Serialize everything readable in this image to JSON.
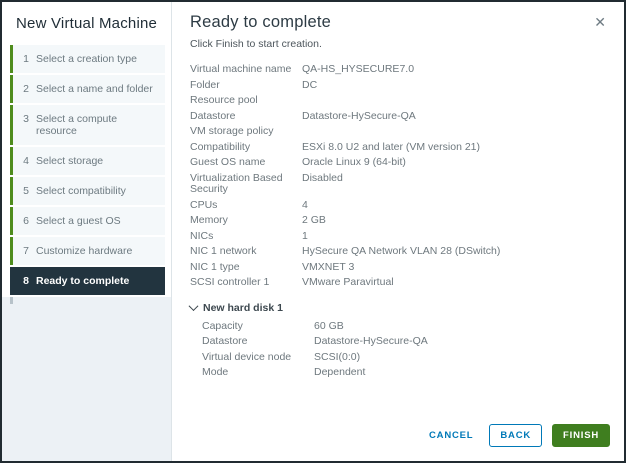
{
  "colors": {
    "step_bar_green": "#4f8c1d",
    "active_step_bg": "#22343f",
    "link_blue": "#0079b8",
    "finish_green": "#3f7e1f",
    "sidebar_filler": "#ecf1f5"
  },
  "icons": {
    "close_glyph": "✕"
  },
  "sidebar": {
    "title": "New Virtual Machine",
    "steps": [
      {
        "num": "1",
        "label": "Select a creation type"
      },
      {
        "num": "2",
        "label": "Select a name and folder"
      },
      {
        "num": "3",
        "label": "Select a compute resource"
      },
      {
        "num": "4",
        "label": "Select storage"
      },
      {
        "num": "5",
        "label": "Select compatibility"
      },
      {
        "num": "6",
        "label": "Select a guest OS"
      },
      {
        "num": "7",
        "label": "Customize hardware"
      },
      {
        "num": "8",
        "label": "Ready to complete"
      }
    ]
  },
  "main": {
    "title": "Ready to complete",
    "subtitle": "Click Finish to start creation.",
    "summary_rows": [
      {
        "label": "Virtual machine name",
        "value": "QA-HS_HYSECURE7.0"
      },
      {
        "label": "Folder",
        "value": "DC"
      },
      {
        "label": "Resource pool",
        "value": ""
      },
      {
        "label": "Datastore",
        "value": "Datastore-HySecure-QA"
      },
      {
        "label": "VM storage policy",
        "value": ""
      },
      {
        "label": "Compatibility",
        "value": "ESXi 8.0 U2 and later (VM version 21)"
      },
      {
        "label": "Guest OS name",
        "value": "Oracle Linux 9 (64-bit)"
      },
      {
        "label": "Virtualization Based Security",
        "value": "Disabled"
      },
      {
        "label": "CPUs",
        "value": "4"
      },
      {
        "label": "Memory",
        "value": "2 GB"
      },
      {
        "label": "NICs",
        "value": "1"
      },
      {
        "label": "NIC 1 network",
        "value": "HySecure QA Network VLAN 28 (DSwitch)"
      },
      {
        "label": "NIC 1 type",
        "value": "VMXNET 3"
      },
      {
        "label": "SCSI controller 1",
        "value": "VMware Paravirtual"
      }
    ],
    "disk_section": {
      "title": "New hard disk 1",
      "rows": [
        {
          "label": "Capacity",
          "value": "60 GB"
        },
        {
          "label": "Datastore",
          "value": "Datastore-HySecure-QA"
        },
        {
          "label": "Virtual device node",
          "value": "SCSI(0:0)"
        },
        {
          "label": "Mode",
          "value": "Dependent"
        }
      ]
    },
    "footer": {
      "cancel_label": "CANCEL",
      "back_label": "BACK",
      "finish_label": "FINISH"
    }
  }
}
